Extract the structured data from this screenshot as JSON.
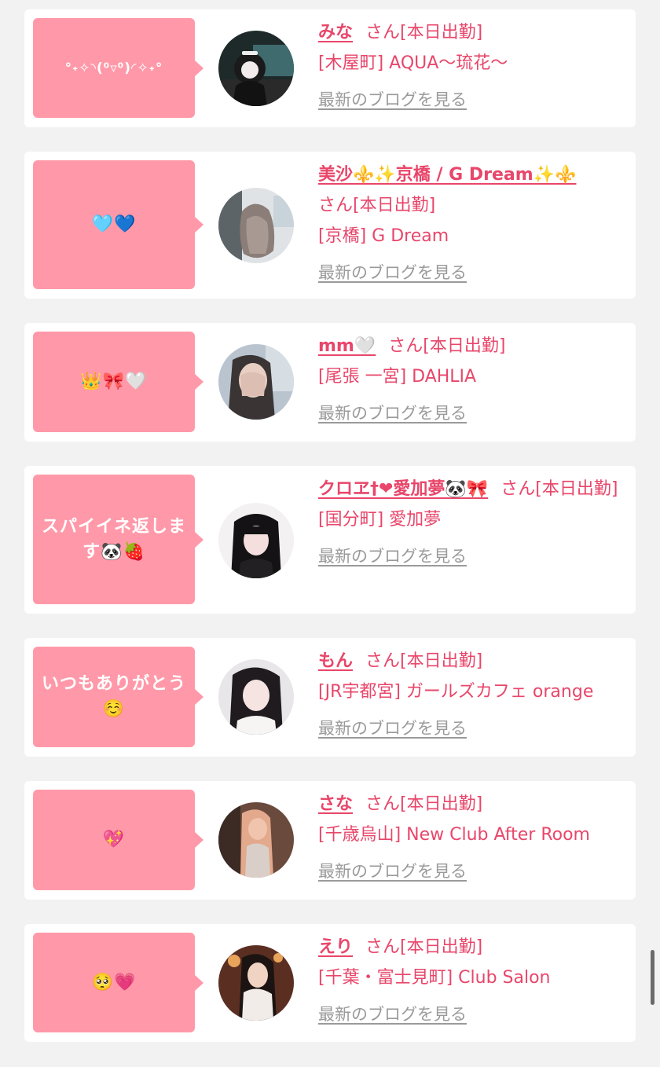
{
  "posts": [
    {
      "comment": "°˖✧◝(⁰▿⁰)◜✧˖°",
      "name": "みな",
      "suffix": "さん[本日出勤]",
      "shop": "[木屋町] AQUA〜琉花〜",
      "blog_link": "最新のブログを見る"
    },
    {
      "comment": "🩵💙",
      "name": "美沙⚜️✨京橋 / G Dream✨⚜️",
      "suffix": "さん[本日出勤]",
      "shop": "[京橋] G Dream",
      "blog_link": "最新のブログを見る"
    },
    {
      "comment": "👑🎀🤍",
      "name": "mm🤍",
      "suffix": "さん[本日出勤]",
      "shop": "[尾張 一宮] DAHLIA",
      "blog_link": "最新のブログを見る"
    },
    {
      "comment": "スパイイネ返します🐼🍓",
      "name": "クロヱ†❤愛加夢🐼🎀",
      "suffix": "さん[本日出勤]",
      "shop": "[国分町] 愛加夢",
      "blog_link": "最新のブログを見る"
    },
    {
      "comment": "いつもありがとう☺️",
      "name": "もん",
      "suffix": "さん[本日出勤]",
      "shop": "[JR宇都宮] ガールズカフェ orange",
      "blog_link": "最新のブログを見る"
    },
    {
      "comment": "💖",
      "name": "さな",
      "suffix": "さん[本日出勤]",
      "shop": "[千歳烏山] New Club After Room",
      "blog_link": "最新のブログを見る"
    },
    {
      "comment": "🥺💗",
      "name": "えり",
      "suffix": "さん[本日出勤]",
      "shop": "[千葉・富士見町] Club Salon",
      "blog_link": "最新のブログを見る"
    }
  ],
  "colors": {
    "accent": "#e8466a",
    "bubble": "#ff99a9",
    "link_gray": "#9a9a9a",
    "background": "#f2f2f2"
  }
}
